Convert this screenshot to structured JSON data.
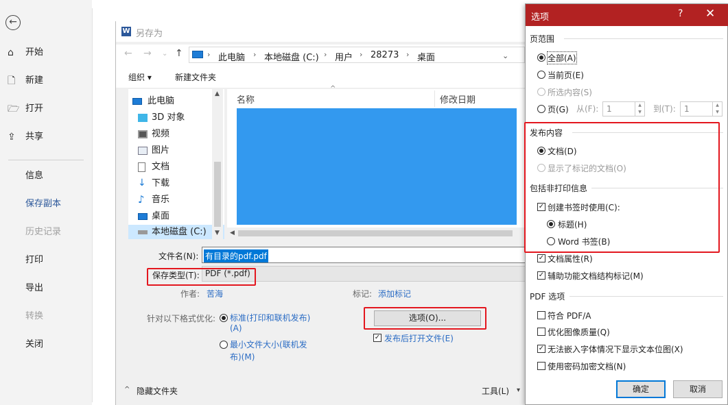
{
  "backstage": {
    "back": "←",
    "items": [
      {
        "label": "开始",
        "icon": "⌂"
      },
      {
        "label": "新建",
        "icon": "🗋"
      },
      {
        "label": "打开",
        "icon": "🗁"
      },
      {
        "label": "共享",
        "icon": "⇪"
      },
      {
        "label": "信息"
      },
      {
        "label": "保存副本"
      },
      {
        "label": "历史记录"
      },
      {
        "label": "打印"
      },
      {
        "label": "导出"
      },
      {
        "label": "转换"
      },
      {
        "label": "关闭"
      }
    ]
  },
  "saveas": {
    "title": "另存为",
    "word_icon": "W",
    "path": [
      "此电脑",
      "本地磁盘 (C:)",
      "用户",
      "28273",
      "桌面"
    ],
    "toolbar": {
      "organize": "组织 ▾",
      "new_folder": "新建文件夹"
    },
    "tree": [
      {
        "label": "此电脑"
      },
      {
        "label": "3D 对象"
      },
      {
        "label": "视频"
      },
      {
        "label": "图片"
      },
      {
        "label": "文档"
      },
      {
        "label": "下载"
      },
      {
        "label": "音乐"
      },
      {
        "label": "桌面"
      },
      {
        "label": "本地磁盘 (C:)"
      }
    ],
    "columns": {
      "name": "名称",
      "date": "修改日期"
    },
    "filename_label": "文件名(N):",
    "filename_value": "有目录的pdf.pdf",
    "savetype_label": "保存类型(T):",
    "savetype_value": "PDF (*.pdf)",
    "author_label": "作者:",
    "author_value": "苦海",
    "tags_label": "标记:",
    "tags_value": "添加标记",
    "optimize_label": "针对以下格式优化:",
    "opt_standard_l1": "标准(打印和联机发布)",
    "opt_standard_l2": "(A)",
    "opt_min_l1": "最小文件大小(联机发",
    "opt_min_l2": "布)(M)",
    "options_button": "选项(O)...",
    "open_after": "发布后打开文件(E)",
    "hide_folders": "隐藏文件夹",
    "tools": "工具(L)"
  },
  "options": {
    "title": "选项",
    "help": "?",
    "close": "✕",
    "page_range": "页范围",
    "all": "全部(A)",
    "current": "当前页(E)",
    "selection": "所选内容(S)",
    "pages": "页(G)",
    "from": "从(F):",
    "from_val": "1",
    "to": "到(T):",
    "to_val": "1",
    "publish": "发布内容",
    "document": "文档(D)",
    "doc_markup": "显示了标记的文档(O)",
    "nonprint": "包括非打印信息",
    "create_bookmarks": "创建书签时使用(C):",
    "headings": "标题(H)",
    "word_bookmarks": "Word 书签(B)",
    "doc_props": "文档属性(R)",
    "struct_tags": "辅助功能文档结构标记(M)",
    "pdf_options": "PDF 选项",
    "pdfa": "符合 PDF/A",
    "optimize_img": "优化图像质量(Q)",
    "bitmap_text": "无法嵌入字体情况下显示文本位图(X)",
    "encrypt": "使用密码加密文档(N)",
    "ok": "确定",
    "cancel": "取消"
  },
  "colors": {
    "accent": "#2b579a",
    "title_bar": "#b22222",
    "highlight": "#e3161e",
    "file_area": "#3399ef"
  }
}
